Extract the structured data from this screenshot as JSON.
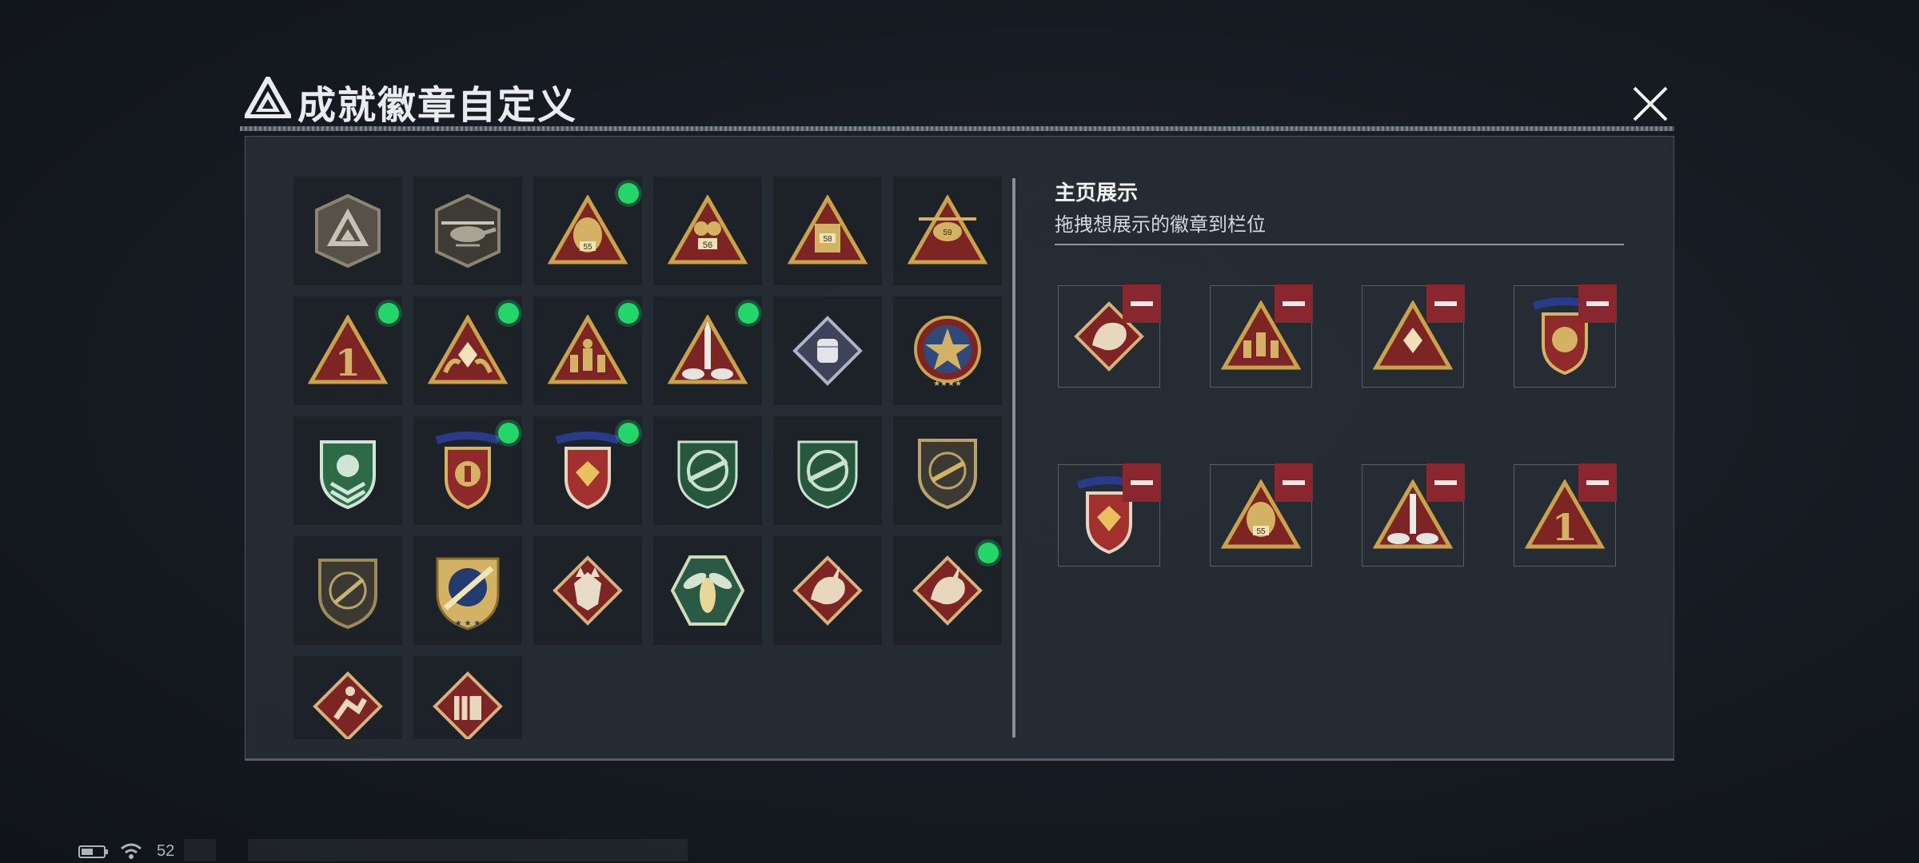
{
  "window": {
    "title": "成就徽章自定义",
    "close_icon": "close-icon"
  },
  "colors": {
    "accent_new": "#22d66a",
    "remove": "#8a262e",
    "panel": "#262c34",
    "gold": "#c9a24a",
    "red": "#7d2424"
  },
  "badge_grid": {
    "rows": [
      [
        {
          "icon": "grey-triangle-shield-badge",
          "new": false
        },
        {
          "icon": "helicopter-shield-badge",
          "new": false
        },
        {
          "icon": "season-55-triangle-badge",
          "new": true
        },
        {
          "icon": "season-56-triangle-badge",
          "new": false
        },
        {
          "icon": "season-58-triangle-badge",
          "new": false
        },
        {
          "icon": "season-59-triangle-badge",
          "new": false
        }
      ],
      [
        {
          "icon": "number-one-triangle-badge",
          "new": true
        },
        {
          "icon": "hands-diamond-triangle-badge",
          "new": true
        },
        {
          "icon": "soldiers-triangle-badge",
          "new": true
        },
        {
          "icon": "rocket-triangle-badge",
          "new": true
        },
        {
          "icon": "fist-diamond-badge",
          "new": false
        },
        {
          "icon": "star-medal-badge",
          "new": false
        }
      ],
      [
        {
          "icon": "green-chevron-shield-badge",
          "new": false
        },
        {
          "icon": "gold-star-crest-badge",
          "new": true
        },
        {
          "icon": "red-gem-crest-badge",
          "new": true
        },
        {
          "icon": "green-rifle-crosshair-badge",
          "new": false
        },
        {
          "icon": "green-rifle-crosshair-badge-2",
          "new": false
        },
        {
          "icon": "gold-rifle-shield-badge",
          "new": false
        }
      ],
      [
        {
          "icon": "bronze-knife-shield-badge",
          "new": false
        },
        {
          "icon": "gold-sword-shield-badge",
          "new": false
        },
        {
          "icon": "wolf-diamond-badge",
          "new": false
        },
        {
          "icon": "hornet-hexagon-badge",
          "new": false
        },
        {
          "icon": "dragon-diamond-badge",
          "new": false
        },
        {
          "icon": "dragon-diamond-badge-2",
          "new": true
        }
      ],
      [
        {
          "icon": "runner-diamond-badge",
          "new": false
        },
        {
          "icon": "fortress-diamond-badge",
          "new": false
        }
      ]
    ]
  },
  "showcase": {
    "title": "主页展示",
    "subtitle": "拖拽想展示的徽章到栏位",
    "slots": [
      {
        "icon": "dragon-diamond-badge"
      },
      {
        "icon": "soldiers-triangle-badge"
      },
      {
        "icon": "hands-diamond-triangle-badge"
      },
      {
        "icon": "gold-star-crest-badge"
      },
      {
        "icon": "red-gem-crest-badge"
      },
      {
        "icon": "season-55-triangle-badge"
      },
      {
        "icon": "rocket-triangle-badge"
      },
      {
        "icon": "number-one-triangle-badge"
      }
    ]
  },
  "statusbar": {
    "battery_icon": "battery-icon",
    "wifi_icon": "wifi-icon",
    "signal_text": "52"
  }
}
